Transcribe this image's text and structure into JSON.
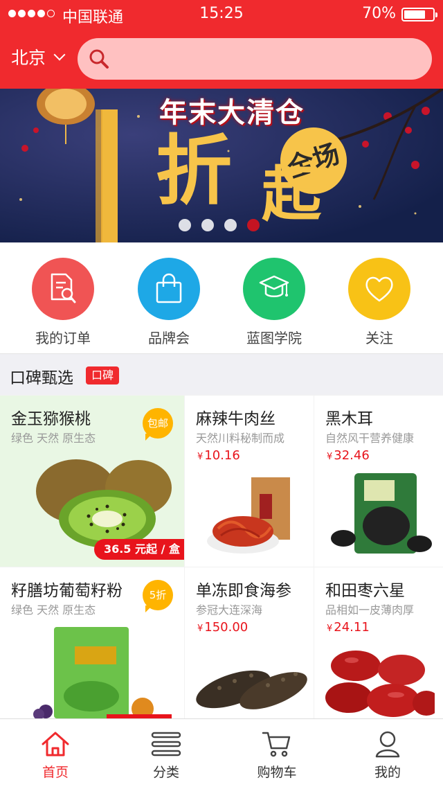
{
  "status_bar": {
    "carrier": "中国联通",
    "time": "15:25",
    "battery": "70%",
    "battery_level": 0.7
  },
  "header": {
    "city": "北京",
    "search_placeholder": ""
  },
  "banner": {
    "title": "年末大清仓",
    "big_char_1": "折",
    "big_char_2": "起",
    "badge": "全场",
    "slide_count": 4,
    "active_slide": 3
  },
  "quick_entries": [
    {
      "label": "我的订单",
      "icon": "order-search-icon",
      "color": "#f05454"
    },
    {
      "label": "品牌会",
      "icon": "shopping-bag-icon",
      "color": "#1ea8e6"
    },
    {
      "label": "蓝图学院",
      "icon": "graduation-cap-icon",
      "color": "#1fc46e"
    },
    {
      "label": "关注",
      "icon": "heart-icon",
      "color": "#f8c216"
    }
  ],
  "section": {
    "title": "口碑甄选",
    "badge": "口碑"
  },
  "products": [
    {
      "name": "金玉猕猴桃",
      "subtitle": "绿色 天然 原生态",
      "tag": "包邮",
      "ribbon": "36.5 元起 / 盒",
      "image": "kiwi"
    },
    {
      "name": "麻辣牛肉丝",
      "subtitle": "天然川料秘制而成",
      "price": "10.16",
      "currency": "¥",
      "image": "beef-shreds"
    },
    {
      "name": "黑木耳",
      "subtitle": "自然风干营养健康",
      "price": "32.46",
      "currency": "¥",
      "image": "black-fungus"
    },
    {
      "name": "籽膳坊葡萄籽粉",
      "subtitle": "绿色 天然 原生态",
      "tag": "5折",
      "image": "grape-seed-powder"
    },
    {
      "name": "单冻即食海参",
      "subtitle": "参冠大连深海",
      "price": "150.00",
      "currency": "¥",
      "image": "sea-cucumber"
    },
    {
      "name": "和田枣六星",
      "subtitle": "品相如一皮薄肉厚",
      "price": "24.11",
      "currency": "¥",
      "image": "red-dates"
    }
  ],
  "tabbar": [
    {
      "label": "首页",
      "icon": "home-icon",
      "active": true
    },
    {
      "label": "分类",
      "icon": "category-icon",
      "active": false
    },
    {
      "label": "购物车",
      "icon": "cart-icon",
      "active": false
    },
    {
      "label": "我的",
      "icon": "user-icon",
      "active": false
    }
  ],
  "colors": {
    "brand": "#f02a2e",
    "price": "#e8141c",
    "tag": "#ffb400"
  }
}
